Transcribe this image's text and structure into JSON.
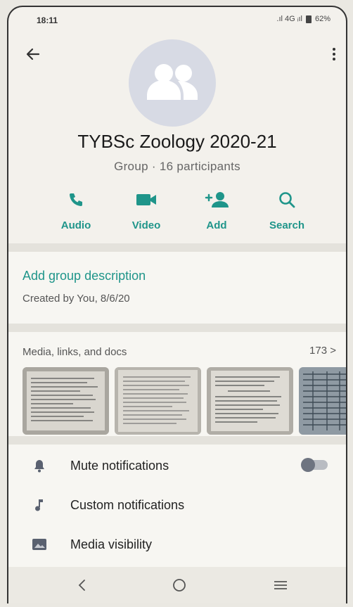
{
  "status_bar": {
    "time": "18:11",
    "signal_text": ".ıl 4G ᵢıl",
    "battery_percent": "62%"
  },
  "header": {
    "back_icon": "arrow-left-icon",
    "menu_icon": "more-vertical-icon",
    "avatar_icon": "group-icon",
    "title": "TYBSc Zoology 2020-21",
    "subtitle": "Group · 16 participants"
  },
  "actions": [
    {
      "label": "Audio",
      "icon": "phone-icon"
    },
    {
      "label": "Video",
      "icon": "videocam-icon"
    },
    {
      "label": "Add",
      "icon": "add-person-icon"
    },
    {
      "label": "Search",
      "icon": "search-icon"
    }
  ],
  "description": {
    "add_label": "Add group description",
    "created": "Created by You, 8/6/20"
  },
  "media": {
    "title": "Media, links, and docs",
    "count": "173 >"
  },
  "settings": [
    {
      "label": "Mute notifications",
      "icon": "bell-icon",
      "toggle_on": false
    },
    {
      "label": "Custom notifications",
      "icon": "music-note-icon"
    },
    {
      "label": "Media visibility",
      "icon": "image-icon"
    }
  ],
  "navigation": {
    "back": "chevron-left-icon",
    "home": "circle-home-icon",
    "recents": "menu-lines-icon"
  },
  "colors": {
    "accent": "#1f958a",
    "background": "#f3f1ec"
  }
}
